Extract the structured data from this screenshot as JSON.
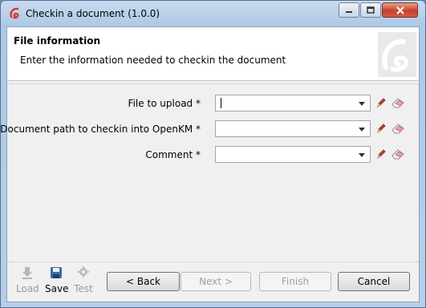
{
  "window": {
    "title": "Checkin a document (1.0.0)"
  },
  "header": {
    "title": "File information",
    "subtitle": "Enter the information needed to checkin the document"
  },
  "form": {
    "fields": [
      {
        "label": "File to upload *",
        "value": ""
      },
      {
        "label": "Document path to checkin into OpenKM *",
        "value": ""
      },
      {
        "label": "Comment *",
        "value": ""
      }
    ]
  },
  "toolbar": {
    "load": "Load",
    "save": "Save",
    "test": "Test"
  },
  "buttons": {
    "back": "< Back",
    "next": "Next >",
    "finish": "Finish",
    "cancel": "Cancel"
  }
}
